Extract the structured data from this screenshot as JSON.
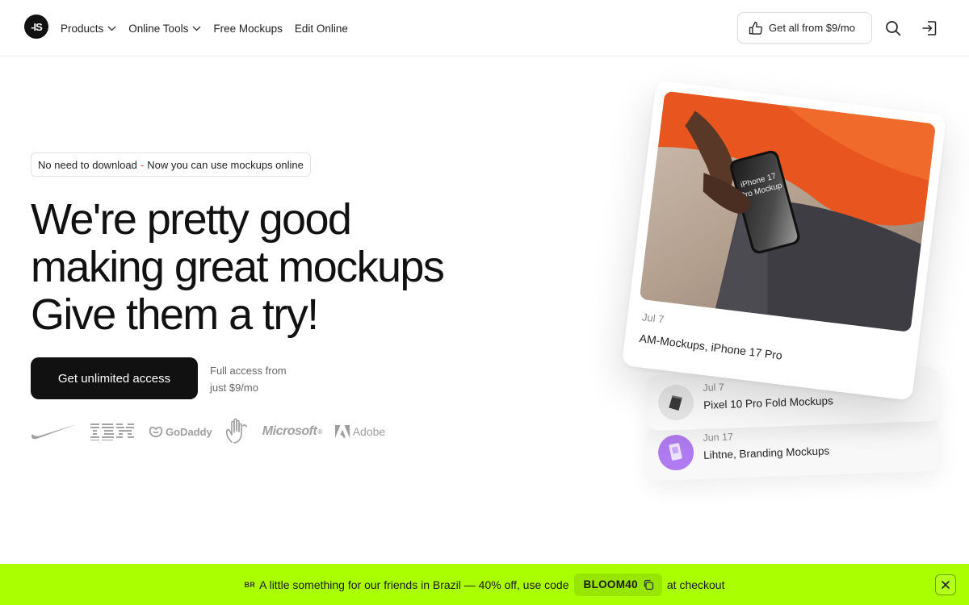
{
  "header": {
    "logo_text": "-IS",
    "nav": [
      {
        "label": "Products",
        "has_dropdown": true
      },
      {
        "label": "Online Tools",
        "has_dropdown": true
      },
      {
        "label": "Free Mockups",
        "has_dropdown": false
      },
      {
        "label": "Edit Online",
        "has_dropdown": false
      }
    ],
    "cta_label": "Get all from $9/mo",
    "search_icon": "search-icon",
    "login_icon": "login-icon"
  },
  "hero": {
    "pill_left": "No need to download",
    "pill_sep": "-",
    "pill_right": "Now you can use mockups online",
    "headline_lines": [
      "We're pretty good",
      "making great mockups",
      "Give them a try!"
    ],
    "cta_label": "Get unlimited access",
    "cta_note_line1": "Full access from",
    "cta_note_line2": "just $9/mo",
    "brands": [
      "Nike",
      "IBM",
      "GoDaddy",
      "hand-logo",
      "Microsoft",
      "Adobe"
    ]
  },
  "cards": {
    "featured": {
      "date": "Jul 7",
      "title": "AM-Mockups, iPhone 17 Pro",
      "phone_text_1": "iPhone 17",
      "phone_text_2": "Pro Mockup"
    },
    "items": [
      {
        "date": "Jul 7",
        "title": "Pixel 10 Pro Fold Mockups"
      },
      {
        "date": "Jun 17",
        "title": "Lihtne, Branding Mockups"
      }
    ]
  },
  "promo": {
    "flag": "BR",
    "text_before": "A little something for our friends in Brazil — 40% off, use code",
    "code": "BLOOM40",
    "text_after": "at checkout",
    "accent": "#aaff00"
  }
}
